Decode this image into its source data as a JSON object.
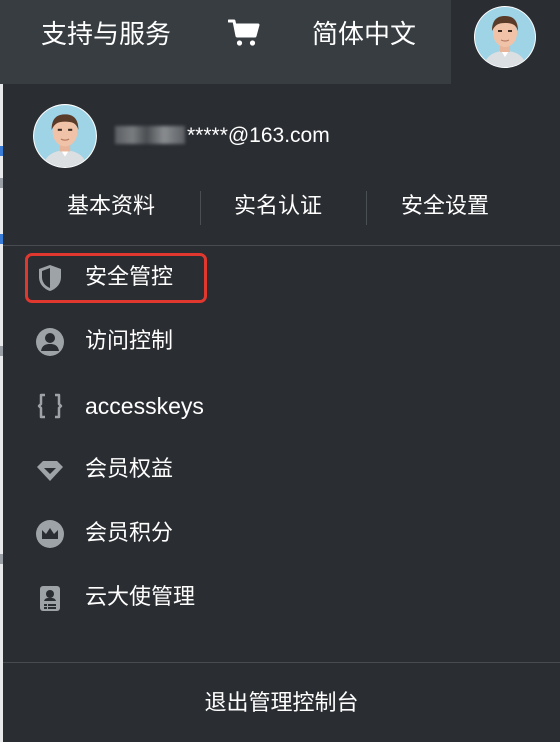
{
  "topbar": {
    "support_label": "支持与服务",
    "cart_icon": "cart-icon",
    "language_label": "简体中文",
    "avatar_icon": "user-avatar"
  },
  "profile": {
    "email_masked": "*****@163.com",
    "links": [
      {
        "label": "基本资料"
      },
      {
        "label": "实名认证"
      },
      {
        "label": "安全设置"
      }
    ]
  },
  "menu": {
    "items": [
      {
        "label": "安全管控",
        "icon": "shield-icon",
        "highlighted": true
      },
      {
        "label": "访问控制",
        "icon": "user-icon"
      },
      {
        "label": "accesskeys",
        "icon": "braces-icon"
      },
      {
        "label": "会员权益",
        "icon": "diamond-icon"
      },
      {
        "label": "会员积分",
        "icon": "crown-icon"
      },
      {
        "label": "云大使管理",
        "icon": "badge-icon"
      }
    ]
  },
  "footer": {
    "logout_label": "退出管理控制台"
  },
  "colors": {
    "topbar_bg": "#373d41",
    "dropdown_bg": "#2a2d32",
    "highlight": "#e0372f",
    "icon_gray": "#9ea3a8"
  }
}
